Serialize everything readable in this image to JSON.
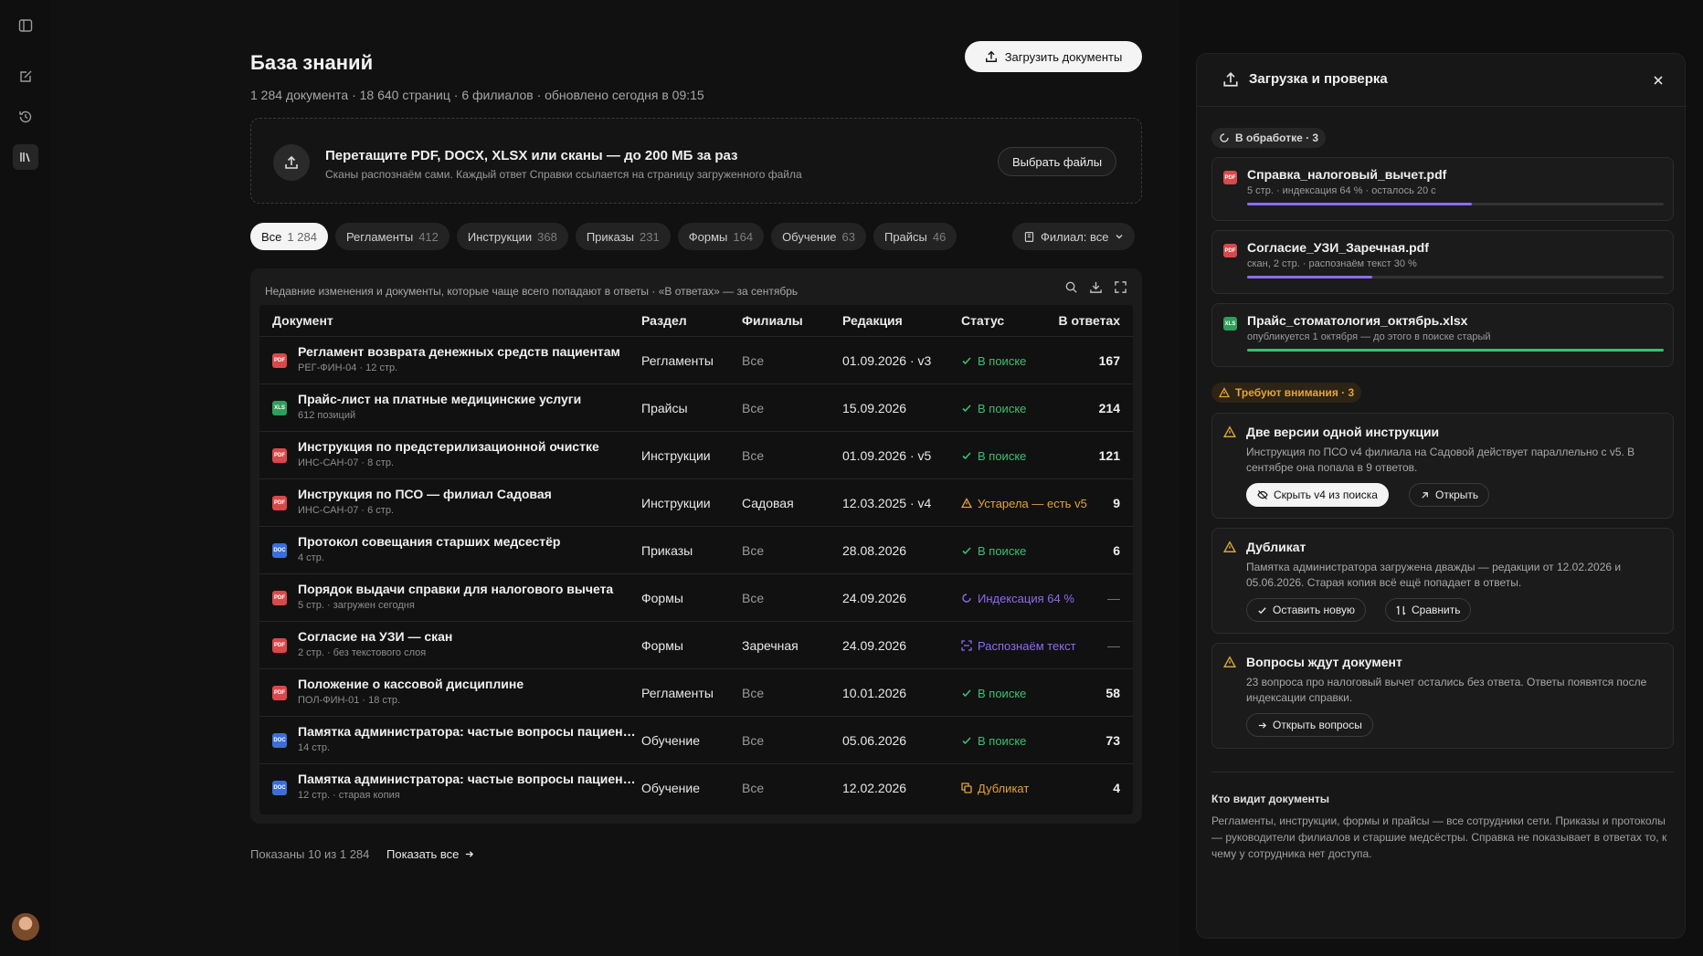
{
  "colors": {
    "green": "#3bbf74",
    "orange": "#e3a33b",
    "purple": "#8b6cf0",
    "pdf": "#d9484a",
    "xls": "#2f9e5a",
    "doc": "#3a6fd8"
  },
  "header": {
    "title": "База знаний",
    "subtitle": "1 284 документа · 18 640 страниц · 6 филиалов · обновлено сегодня в 09:15",
    "upload_label": "Загрузить документы"
  },
  "drop": {
    "title": "Перетащите PDF, DOCX, XLSX или сканы — до 200 МБ за раз",
    "subtitle": "Сканы распознаём сами. Каждый ответ Справки ссылается на страницу загруженного файла",
    "choose_label": "Выбрать файлы"
  },
  "filters": [
    {
      "label": "Все",
      "count": "1 284",
      "active": true
    },
    {
      "label": "Регламенты",
      "count": "412"
    },
    {
      "label": "Инструкции",
      "count": "368"
    },
    {
      "label": "Приказы",
      "count": "231"
    },
    {
      "label": "Формы",
      "count": "164"
    },
    {
      "label": "Обучение",
      "count": "63"
    },
    {
      "label": "Прайсы",
      "count": "46"
    }
  ],
  "branch_filter": "Филиал: все",
  "table": {
    "caption": "Недавние изменения и документы, которые чаще всего попадают в ответы · «В ответах» — за сентябрь",
    "headers": [
      "Документ",
      "Раздел",
      "Филиалы",
      "Редакция",
      "Статус",
      "В ответах"
    ],
    "rows": [
      {
        "type": "PDF",
        "name": "Регламент возврата денежных средств пациентам",
        "meta": "РЕГ-ФИН-04 · 12 стр.",
        "section": "Регламенты",
        "branches": "Все",
        "rev": "01.09.2026 · v3",
        "status": "В поиске",
        "status_kind": "ok",
        "count": "167"
      },
      {
        "type": "XLS",
        "name": "Прайс-лист на платные медицинские услуги",
        "meta": "612 позиций",
        "section": "Прайсы",
        "branches": "Все",
        "rev": "15.09.2026",
        "status": "В поиске",
        "status_kind": "ok",
        "count": "214"
      },
      {
        "type": "PDF",
        "name": "Инструкция по предстерилизационной очистке",
        "meta": "ИНС-САН-07 · 8 стр.",
        "section": "Инструкции",
        "branches": "Все",
        "rev": "01.09.2026 · v5",
        "status": "В поиске",
        "status_kind": "ok",
        "count": "121"
      },
      {
        "type": "PDF",
        "name": "Инструкция по ПСО — филиал Садовая",
        "meta": "ИНС-САН-07 · 6 стр.",
        "section": "Инструкции",
        "branches": "Садовая",
        "rev": "12.03.2025 · v4",
        "status": "Устарела — есть v5",
        "status_kind": "warn",
        "count": "9"
      },
      {
        "type": "DOC",
        "name": "Протокол совещания старших медсестёр",
        "meta": "4 стр.",
        "section": "Приказы",
        "branches": "Все",
        "rev": "28.08.2026",
        "status": "В поиске",
        "status_kind": "ok",
        "count": "6"
      },
      {
        "type": "PDF",
        "name": "Порядок выдачи справки для налогового вычета",
        "meta": "5 стр. · загружен сегодня",
        "section": "Формы",
        "branches": "Все",
        "rev": "24.09.2026",
        "status": "Индексация 64 %",
        "status_kind": "proc",
        "count": "—"
      },
      {
        "type": "PDF",
        "name": "Согласие на УЗИ — скан",
        "meta": "2 стр. · без текстового слоя",
        "section": "Формы",
        "branches": "Заречная",
        "rev": "24.09.2026",
        "status": "Распознаём текст",
        "status_kind": "scan",
        "count": "—"
      },
      {
        "type": "PDF",
        "name": "Положение о кассовой дисциплине",
        "meta": "ПОЛ-ФИН-01 · 18 стр.",
        "section": "Регламенты",
        "branches": "Все",
        "rev": "10.01.2026",
        "status": "В поиске",
        "status_kind": "ok",
        "count": "58"
      },
      {
        "type": "DOC",
        "name": "Памятка администратора: частые вопросы пациентов",
        "meta": "14 стр.",
        "section": "Обучение",
        "branches": "Все",
        "rev": "05.06.2026",
        "status": "В поиске",
        "status_kind": "ok",
        "count": "73"
      },
      {
        "type": "DOC",
        "name": "Памятка администратора: частые вопросы пациентов",
        "meta": "12 стр. · старая копия",
        "section": "Обучение",
        "branches": "Все",
        "rev": "12.02.2026",
        "status": "Дубликат",
        "status_kind": "dup",
        "count": "4"
      }
    ]
  },
  "footer": {
    "shown": "Показаны 10 из 1 284",
    "show_all": "Показать все"
  },
  "panel": {
    "title": "Загрузка и проверка",
    "processing_tag": "В обработке · 3",
    "files": [
      {
        "type": "PDF",
        "name": "Справка_налоговый_вычет.pdf",
        "meta": "5 стр. · индексация 64 % · осталось 20 с",
        "progress": 0.54,
        "color": "#8b6cf0"
      },
      {
        "type": "PDF",
        "name": "Согласие_УЗИ_Заречная.pdf",
        "meta": "скан, 2 стр. · распознаём текст 30 %",
        "progress": 0.3,
        "color": "#8b6cf0"
      },
      {
        "type": "XLS",
        "name": "Прайс_стоматология_октябрь.xlsx",
        "meta": "опубликуется 1 октября — до этого в поиске старый",
        "progress": 1.0,
        "color": "#3bbf74"
      }
    ],
    "attention_tag": "Требуют внимания · 3",
    "warnings": [
      {
        "title": "Две версии одной инструкции",
        "desc": "Инструкция по ПСО v4 филиала на Садовой действует параллельно с v5. В сентябре она попала в 9 ответов.",
        "actions": [
          "Скрыть v4 из поиска",
          "Открыть"
        ]
      },
      {
        "title": "Дубликат",
        "desc": "Памятка администратора загружена дважды — редакции от 12.02.2026 и 05.06.2026. Старая копия всё ещё попадает в ответы.",
        "actions": [
          "Оставить новую",
          "Сравнить"
        ]
      },
      {
        "title": "Вопросы ждут документ",
        "desc": "23 вопроса про налоговый вычет остались без ответа. Ответы появятся после индексации справки.",
        "actions": [
          "Открыть вопросы"
        ]
      }
    ],
    "who_title": "Кто видит документы",
    "who_desc": "Регламенты, инструкции, формы и прайсы — все сотрудники сети. Приказы и протоколы — руководители филиалов и старшие медсёстры. Справка не показывает в ответах то, к чему у сотрудника нет доступа."
  }
}
